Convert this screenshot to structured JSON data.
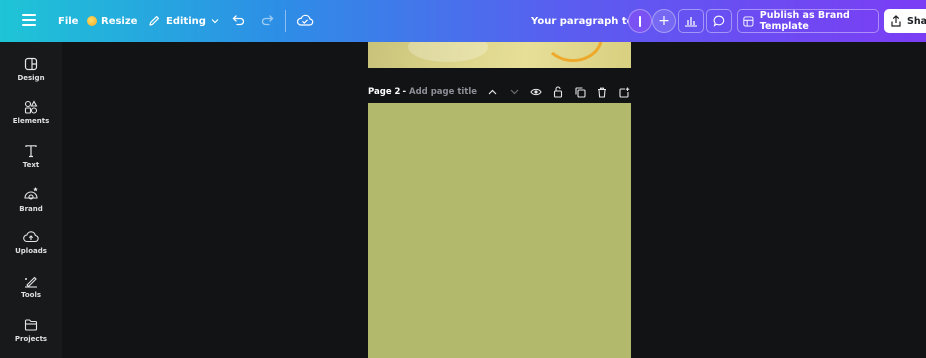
{
  "topbar": {
    "file_label": "File",
    "resize_label": "Resize",
    "editing_label": "Editing",
    "text_preview": "Your paragraph text",
    "publish_label": "Publish as Brand Template",
    "share_label": "Sha",
    "gradient_colors": [
      "#1ec5d6",
      "#2d8ee6",
      "#5b5cf0",
      "#7b3df4"
    ]
  },
  "sidebar": {
    "items": [
      {
        "label": "Design",
        "icon": "design-icon"
      },
      {
        "label": "Elements",
        "icon": "elements-icon"
      },
      {
        "label": "Text",
        "icon": "text-icon"
      },
      {
        "label": "Brand",
        "icon": "brand-icon"
      },
      {
        "label": "Uploads",
        "icon": "uploads-icon"
      },
      {
        "label": "Tools",
        "icon": "tools-icon"
      },
      {
        "label": "Projects",
        "icon": "projects-icon"
      }
    ]
  },
  "canvas": {
    "page2_label": "Page 2",
    "page2_separator": "-",
    "page2_title_placeholder": "Add page title",
    "page2_color": "#b3b96c",
    "page_icons": [
      "chevron-up-icon",
      "chevron-down-icon",
      "eye-icon",
      "lock-icon",
      "duplicate-icon",
      "trash-icon",
      "add-page-icon"
    ]
  }
}
